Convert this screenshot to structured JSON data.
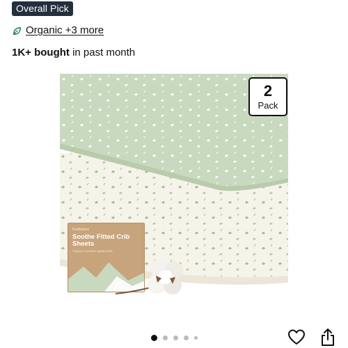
{
  "badge": {
    "label": "Overall Pick"
  },
  "attributes": {
    "icon": "leaf-icon",
    "link_text": "Organic +3 more"
  },
  "social_proof": {
    "count": "1K+ bought",
    "suffix": " in past month"
  },
  "product": {
    "pack_number": "2",
    "pack_word": "Pack",
    "box_brand": "KeaBabies",
    "box_title": "Soothe Fitted Crib Sheets",
    "box_subtitle": "Organic & premium quality fabric",
    "colors": {
      "sage": "#c9d9bf",
      "cream": "#f6f3ea",
      "box": "#c8a47c"
    }
  },
  "carousel": {
    "total": 5,
    "active_index": 0
  },
  "actions": {
    "favorite_icon": "heart-icon",
    "share_icon": "share-icon"
  }
}
